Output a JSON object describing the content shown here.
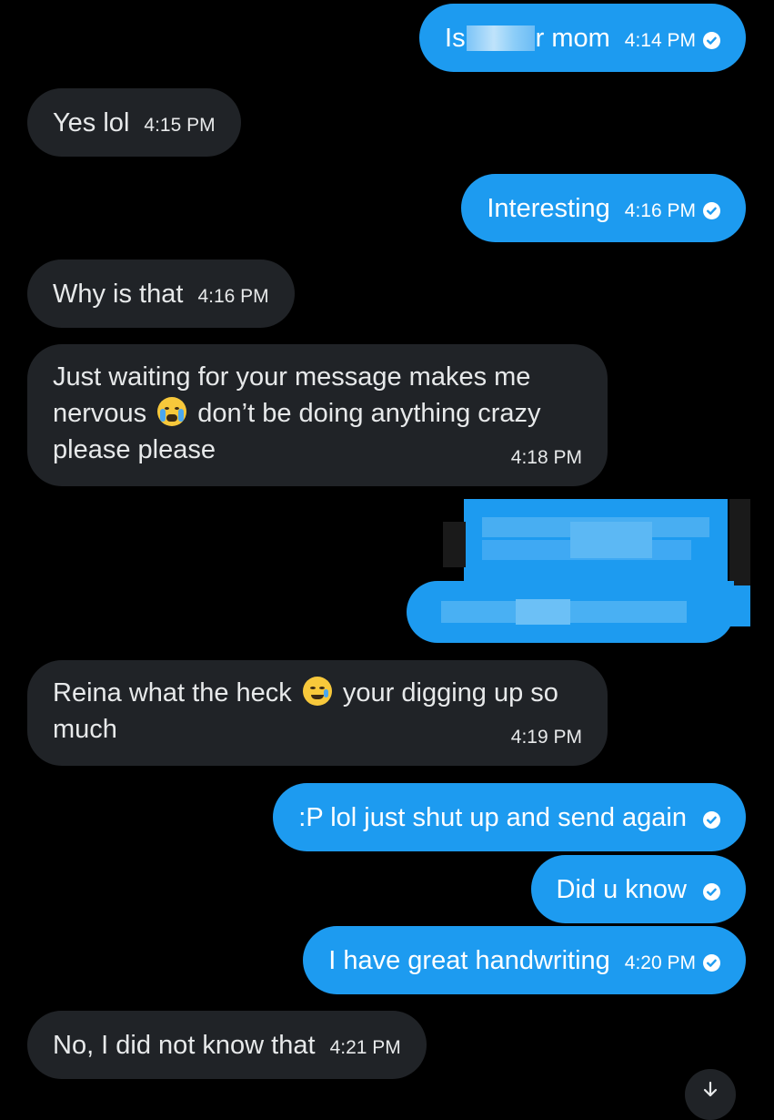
{
  "conversation": {
    "messages": [
      {
        "side": "out",
        "text_before": "Is",
        "text_after": "r mom",
        "time": "4:14 PM",
        "redacted": true
      },
      {
        "side": "in",
        "text": "Yes lol",
        "time": "4:15 PM"
      },
      {
        "side": "out",
        "text": "Interesting",
        "time": "4:16 PM"
      },
      {
        "side": "in",
        "text": "Why is that",
        "time": "4:16 PM"
      },
      {
        "side": "in",
        "text_part1": "Just waiting for your message makes me nervous",
        "text_part2": "don’t be doing anything crazy please please",
        "emoji": "loudly-crying-face-emoji",
        "time": "4:18 PM"
      },
      {
        "side": "out",
        "pixelated": true
      },
      {
        "side": "in",
        "text_part1": "Reina what the heck",
        "text_part2": "your digging up so much",
        "emoji": "smiling-face-with-tear-emoji",
        "time": "4:19 PM"
      },
      {
        "side": "out",
        "text": ":P lol just shut up and send again"
      },
      {
        "side": "out",
        "text": "Did u know"
      },
      {
        "side": "out",
        "text": "I have great handwriting",
        "time": "4:20 PM"
      },
      {
        "side": "in",
        "text": "No, I did not know that",
        "time": "4:21 PM"
      }
    ]
  },
  "colors": {
    "background": "#000000",
    "incoming_bubble": "#202327",
    "outgoing_bubble": "#1d9bf0",
    "text": "#e7e9ea"
  },
  "icons": {
    "read_receipt": "check-circle-icon",
    "scroll_down": "arrow-down-icon"
  }
}
